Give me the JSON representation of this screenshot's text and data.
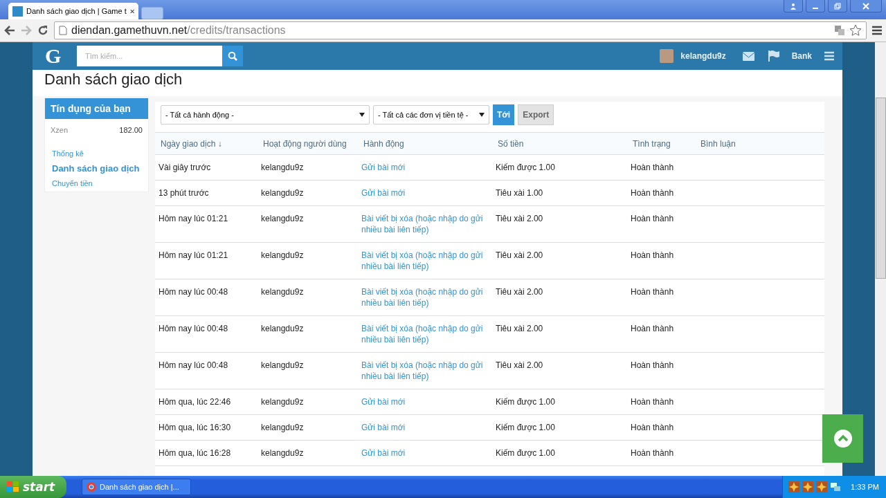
{
  "browser": {
    "tab_title": "Danh sách giao dịch | Game t",
    "url_host": "diendan.gamethuvn.net",
    "url_path": "/credits/transactions"
  },
  "site_header": {
    "logo": "G",
    "search_placeholder": "Tìm kiếm...",
    "username": "kelangdu9z",
    "bank": "Bank"
  },
  "page_title": "Danh sách giao dịch",
  "sidebar": {
    "title": "Tín dụng của bạn",
    "credit": {
      "name": "Xzen",
      "amount": "182.00"
    },
    "links": [
      {
        "label": "Thống kê",
        "selected": false
      },
      {
        "label": "Danh sách giao dịch",
        "selected": true
      },
      {
        "label": "Chuyển tiền",
        "selected": false
      }
    ]
  },
  "filters": {
    "action_select": "- Tất cả hành động -",
    "currency_select": "- Tất cả các đơn vị tiền tệ -",
    "go_button": "Tới",
    "export_button": "Export"
  },
  "table": {
    "columns": [
      "Ngày giao dịch ↓",
      "Hoạt động người dùng",
      "Hành động",
      "Số tiền",
      "Tình trạng",
      "Bình luận"
    ],
    "rows": [
      {
        "date": "Vài giây trước",
        "user": "kelangdu9z",
        "action": "Gửi bài mới",
        "amount": "Kiếm được 1.00",
        "status": "Hoàn thành"
      },
      {
        "date": "13 phút trước",
        "user": "kelangdu9z",
        "action": "Gửi bài mới",
        "amount": "Tiêu xài 1.00",
        "status": "Hoàn thành"
      },
      {
        "date": "Hôm nay lúc 01:21",
        "user": "kelangdu9z",
        "action": "Bài viết bị xóa (hoặc nhập do gửi nhiều bài liên tiếp)",
        "amount": "Tiêu xài 2.00",
        "status": "Hoàn thành"
      },
      {
        "date": "Hôm nay lúc 01:21",
        "user": "kelangdu9z",
        "action": "Bài viết bị xóa (hoặc nhập do gửi nhiều bài liên tiếp)",
        "amount": "Tiêu xài 2.00",
        "status": "Hoàn thành"
      },
      {
        "date": "Hôm nay lúc 00:48",
        "user": "kelangdu9z",
        "action": "Bài viết bị xóa (hoặc nhập do gửi nhiều bài liên tiếp)",
        "amount": "Tiêu xài 2.00",
        "status": "Hoàn thành"
      },
      {
        "date": "Hôm nay lúc 00:48",
        "user": "kelangdu9z",
        "action": "Bài viết bị xóa (hoặc nhập do gửi nhiều bài liên tiếp)",
        "amount": "Tiêu xài 2.00",
        "status": "Hoàn thành"
      },
      {
        "date": "Hôm nay lúc 00:48",
        "user": "kelangdu9z",
        "action": "Bài viết bị xóa (hoặc nhập do gửi nhiều bài liên tiếp)",
        "amount": "Tiêu xài 2.00",
        "status": "Hoàn thành"
      },
      {
        "date": "Hôm qua, lúc 22:46",
        "user": "kelangdu9z",
        "action": "Gửi bài mới",
        "amount": "Kiếm được 1.00",
        "status": "Hoàn thành"
      },
      {
        "date": "Hôm qua, lúc 16:30",
        "user": "kelangdu9z",
        "action": "Gửi bài mới",
        "amount": "Kiếm được 1.00",
        "status": "Hoàn thành"
      },
      {
        "date": "Hôm qua, lúc 16:28",
        "user": "kelangdu9z",
        "action": "Gửi bài mới",
        "amount": "Kiếm được 1.00",
        "status": "Hoàn thành"
      }
    ]
  },
  "taskbar": {
    "start": "start",
    "window": "Danh sách giao dịch |...",
    "clock": "1:33 PM"
  }
}
